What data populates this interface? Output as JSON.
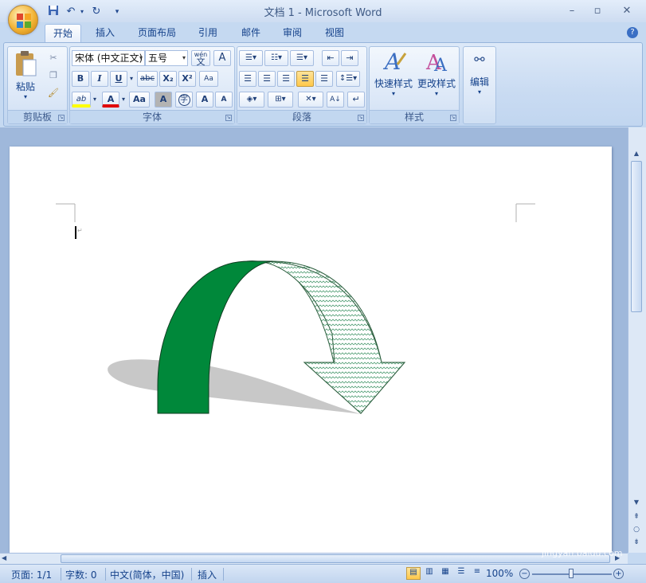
{
  "window": {
    "title": "文档 1 - Microsoft Word",
    "controls": [
      "minimize",
      "maximize",
      "close"
    ]
  },
  "quick_access": {
    "icons": [
      "save-icon",
      "undo-icon",
      "redo-icon",
      "customize-icon"
    ]
  },
  "tabs": [
    {
      "label": "开始",
      "active": true
    },
    {
      "label": "插入"
    },
    {
      "label": "页面布局"
    },
    {
      "label": "引用"
    },
    {
      "label": "邮件"
    },
    {
      "label": "审阅"
    },
    {
      "label": "视图"
    }
  ],
  "ribbon": {
    "clipboard": {
      "label": "剪贴板",
      "paste": "粘贴"
    },
    "font": {
      "label": "字体",
      "font_name": "宋体 (中文正文)",
      "font_size": "五号",
      "wen_label": "wén",
      "wen_char": "文",
      "a_box": "A",
      "bold": "B",
      "italic": "I",
      "underline": "U",
      "strike": "abc",
      "subscript": "X₂",
      "superscript": "X²",
      "clear": "Aa",
      "highlight": "ab",
      "font_color": "A",
      "change_case": "Aa",
      "char_shade": "A",
      "enclose": "字",
      "grow": "A",
      "shrink": "A"
    },
    "paragraph": {
      "label": "段落"
    },
    "styles": {
      "label": "样式",
      "quick": "快速样式",
      "change": "更改样式"
    },
    "editing": {
      "label": "编辑"
    }
  },
  "status": {
    "page": "页面: 1/1",
    "words": "字数: 0",
    "language": "中文(简体，中国)",
    "mode": "插入",
    "zoom": "100%"
  },
  "colors": {
    "arrow_green": "#00883a",
    "arrow_pattern": "#5aa37c",
    "shadow": "#c8c8c8"
  },
  "watermark": "Baidu经验 jingyan.baidu.com"
}
